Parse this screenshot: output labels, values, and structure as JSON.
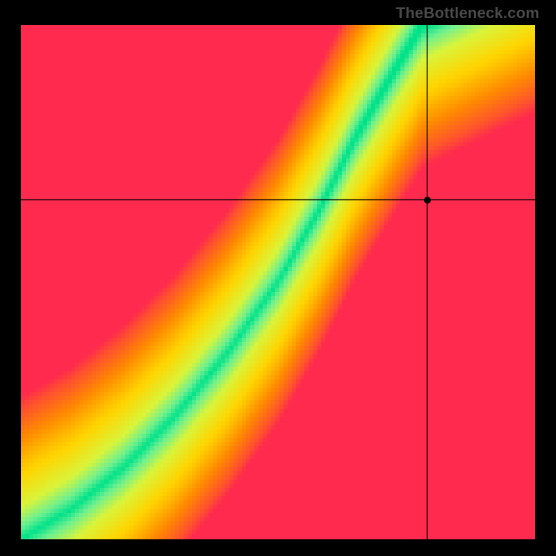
{
  "watermark": {
    "text": "TheBottleneck.com"
  },
  "chart_data": {
    "type": "heatmap",
    "title": "",
    "xlabel": "",
    "ylabel": "",
    "xlim": [
      0,
      1
    ],
    "ylim": [
      0,
      1
    ],
    "crosshair": {
      "x": 0.79,
      "y": 0.66
    },
    "marker": {
      "x": 0.79,
      "y": 0.66
    },
    "optimal_curve": {
      "description": "green ridge (optimal balance line) running roughly diagonally with a slight S-bend, steeper in upper half",
      "points": [
        {
          "x": 0.0,
          "y": 0.0
        },
        {
          "x": 0.1,
          "y": 0.06
        },
        {
          "x": 0.2,
          "y": 0.14
        },
        {
          "x": 0.3,
          "y": 0.24
        },
        {
          "x": 0.4,
          "y": 0.36
        },
        {
          "x": 0.5,
          "y": 0.5
        },
        {
          "x": 0.58,
          "y": 0.64
        },
        {
          "x": 0.65,
          "y": 0.78
        },
        {
          "x": 0.72,
          "y": 0.9
        },
        {
          "x": 0.78,
          "y": 1.0
        }
      ]
    },
    "color_stops": [
      {
        "value": 0.0,
        "color": "#ff2a4d"
      },
      {
        "value": 0.35,
        "color": "#ff8a00"
      },
      {
        "value": 0.6,
        "color": "#ffd400"
      },
      {
        "value": 0.8,
        "color": "#d9f43a"
      },
      {
        "value": 0.92,
        "color": "#6ef090"
      },
      {
        "value": 1.0,
        "color": "#00e28a"
      }
    ],
    "grid": false,
    "legend": false
  }
}
